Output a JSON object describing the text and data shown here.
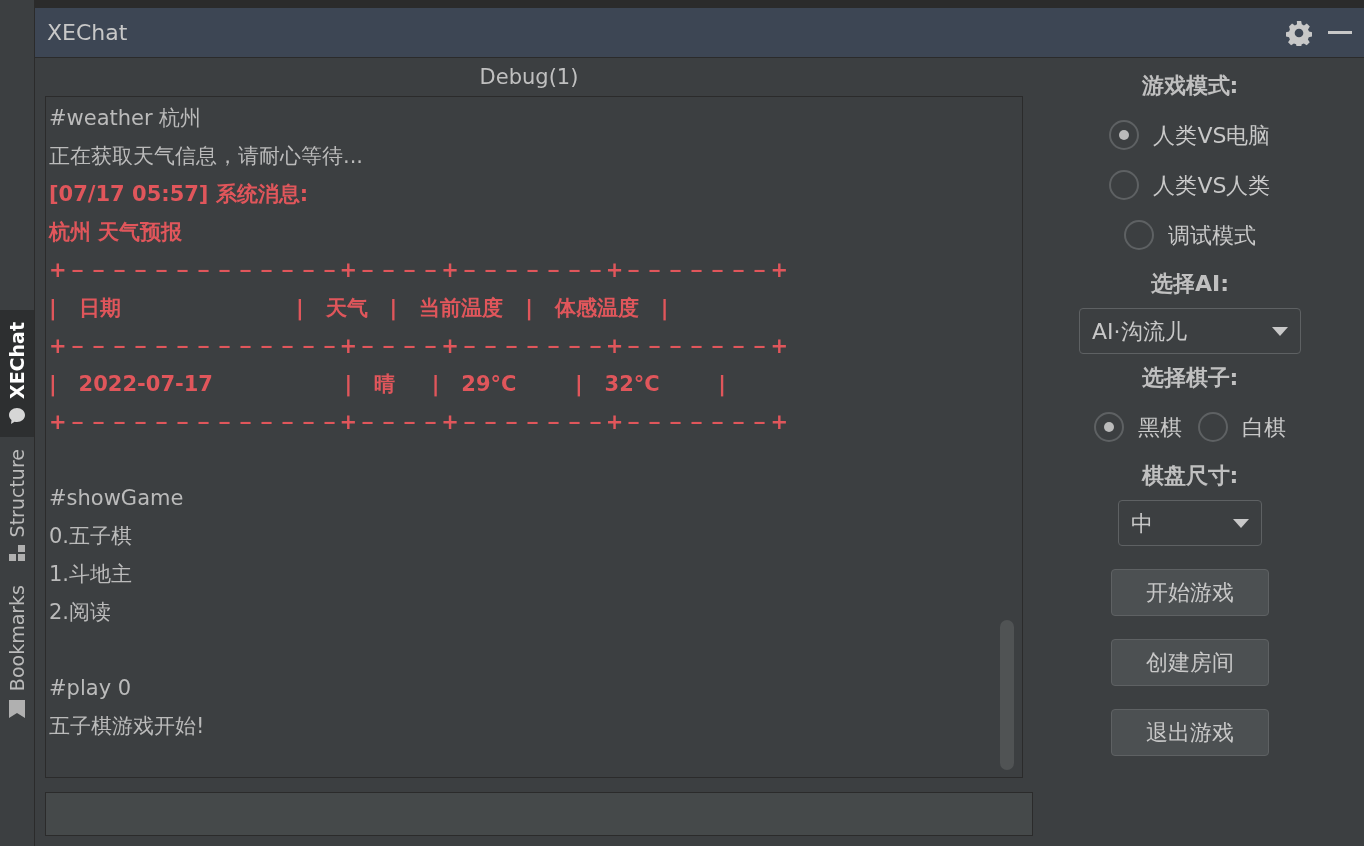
{
  "sidebar": {
    "tabs": [
      {
        "label": "XEChat",
        "selected": true
      },
      {
        "label": "Structure",
        "selected": false
      },
      {
        "label": "Bookmarks",
        "selected": false
      }
    ]
  },
  "window": {
    "title": "XEChat"
  },
  "chat": {
    "title": "Debug(1)",
    "blocks": [
      {
        "lines": [
          {
            "text": "#weather 杭州",
            "kind": "normal"
          },
          {
            "text": "正在获取天气信息，请耐心等待...",
            "kind": "normal"
          },
          {
            "text": "[07/17 05:57] 系统消息:",
            "kind": "alert"
          },
          {
            "text": "杭州 天气预报",
            "kind": "alert"
          },
          {
            "text": "+－－－－－－－－－－－－－+－－－－+－－－－－－－+－－－－－－－+",
            "kind": "alert"
          },
          {
            "text": "|   日期                        |   天气   |   当前温度   |   体感温度   |",
            "kind": "alert"
          },
          {
            "text": "+－－－－－－－－－－－－－+－－－－+－－－－－－－+－－－－－－－+",
            "kind": "alert"
          },
          {
            "text": "|   2022-07-17                  |   晴     |   29°C        |   32°C        |",
            "kind": "alert"
          },
          {
            "text": "+－－－－－－－－－－－－－+－－－－+－－－－－－－+－－－－－－－+",
            "kind": "alert"
          }
        ]
      },
      {
        "lines": [
          {
            "text": "#showGame",
            "kind": "normal"
          },
          {
            "text": "0.五子棋",
            "kind": "normal"
          },
          {
            "text": "1.斗地主",
            "kind": "normal"
          },
          {
            "text": "2.阅读",
            "kind": "normal"
          }
        ]
      },
      {
        "lines": [
          {
            "text": "#play 0",
            "kind": "normal"
          },
          {
            "text": "五子棋游戏开始!",
            "kind": "normal"
          }
        ]
      }
    ]
  },
  "panel": {
    "game_mode": {
      "label": "游戏模式:",
      "options": [
        {
          "label": "人类VS电脑",
          "selected": true
        },
        {
          "label": "人类VS人类",
          "selected": false
        },
        {
          "label": "调试模式",
          "selected": false
        }
      ]
    },
    "ai": {
      "label": "选择AI:",
      "value": "AI·沟流儿"
    },
    "piece": {
      "label": "选择棋子:",
      "options": [
        {
          "label": "黑棋",
          "selected": true
        },
        {
          "label": "白棋",
          "selected": false
        }
      ]
    },
    "board_size": {
      "label": "棋盘尺寸:",
      "value": "中"
    },
    "buttons": [
      "开始游戏",
      "创建房间",
      "退出游戏"
    ]
  }
}
